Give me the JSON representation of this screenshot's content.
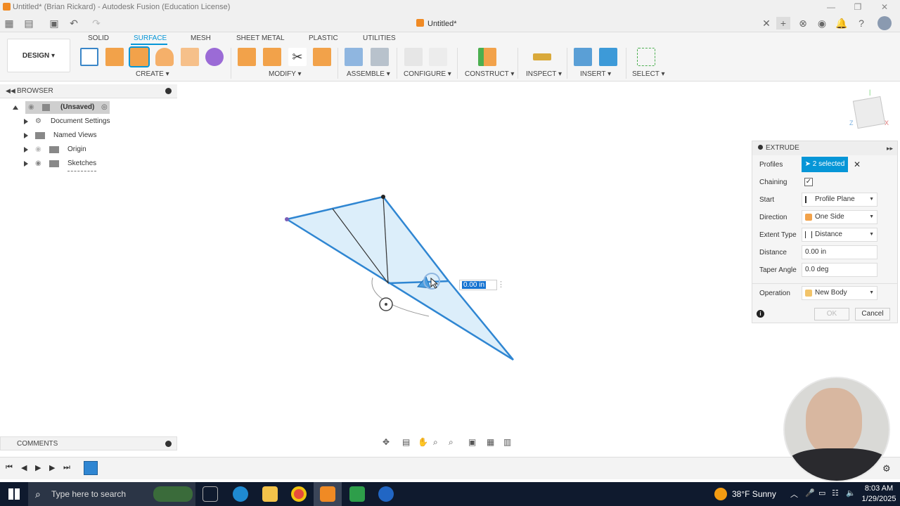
{
  "window": {
    "title": "Untitled* (Brian Rickard) - Autodesk Fusion (Education License)",
    "doc_tab": "Untitled*"
  },
  "ribbon": {
    "workspace": "DESIGN ▾",
    "tabs": [
      "SOLID",
      "SURFACE",
      "MESH",
      "SHEET METAL",
      "PLASTIC",
      "UTILITIES"
    ],
    "active_tab": "SURFACE",
    "groups": [
      "CREATE ▾",
      "MODIFY ▾",
      "ASSEMBLE ▾",
      "CONFIGURE ▾",
      "CONSTRUCT ▾",
      "INSPECT ▾",
      "INSERT ▾",
      "SELECT ▾"
    ]
  },
  "browser": {
    "title": "BROWSER",
    "items": [
      {
        "label": "(Unsaved)"
      },
      {
        "label": "Document Settings"
      },
      {
        "label": "Named Views"
      },
      {
        "label": "Origin"
      },
      {
        "label": "Sketches"
      }
    ]
  },
  "comments": {
    "title": "COMMENTS"
  },
  "viewport": {
    "distance_input": "0.00 in"
  },
  "extrude": {
    "title": "EXTRUDE",
    "rows": {
      "profiles_label": "Profiles",
      "profiles_value": "2 selected",
      "chaining_label": "Chaining",
      "chaining_checked": true,
      "start_label": "Start",
      "start_value": "Profile Plane",
      "direction_label": "Direction",
      "direction_value": "One Side",
      "extent_label": "Extent Type",
      "extent_value": "Distance",
      "distance_label": "Distance",
      "distance_value": "0.00 in",
      "taper_label": "Taper Angle",
      "taper_value": "0.0 deg",
      "operation_label": "Operation",
      "operation_value": "New Body"
    },
    "ok": "OK",
    "cancel": "Cancel"
  },
  "taskbar": {
    "search_placeholder": "Type here to search",
    "weather": "38°F  Sunny",
    "time": "8:03 AM",
    "date": "1/29/2025"
  },
  "colors": {
    "accent": "#0696d7",
    "taskbar": "#0f1a2e"
  }
}
